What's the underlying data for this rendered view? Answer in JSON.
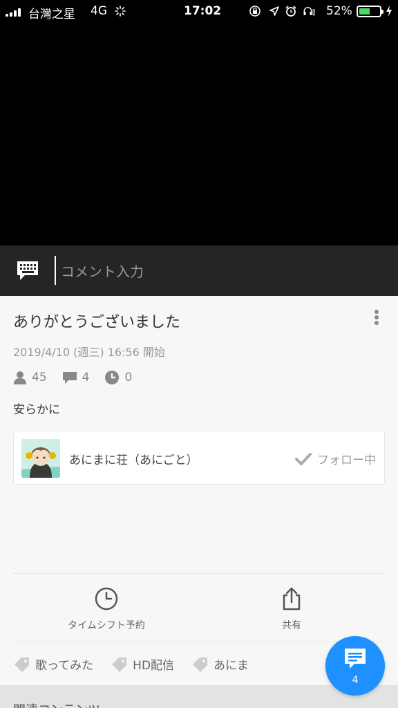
{
  "status_bar": {
    "carrier": "台灣之星",
    "network": "4G",
    "time": "17:02",
    "battery_percent": "52%",
    "battery_level": 0.52
  },
  "comment_bar": {
    "placeholder": "コメント入力"
  },
  "program": {
    "title": "ありがとうございました",
    "start_time": "2019/4/10 (週三) 16:56 開始",
    "viewers": "45",
    "comments": "4",
    "timeshift_reservations": "0",
    "description": "安らかに"
  },
  "channel": {
    "name": "あにまに荘（あにごと）",
    "follow_status": "フォロー中"
  },
  "actions": {
    "timeshift_label": "タイムシフト予約",
    "share_label": "共有"
  },
  "tags": [
    "歌ってみた",
    "HD配信",
    "あにま"
  ],
  "related": {
    "label": "関連コンテンツ"
  },
  "fab": {
    "count": "4"
  },
  "colors": {
    "accent": "#1e90ff",
    "comment_bar": "#252525",
    "battery": "#4cd964"
  }
}
